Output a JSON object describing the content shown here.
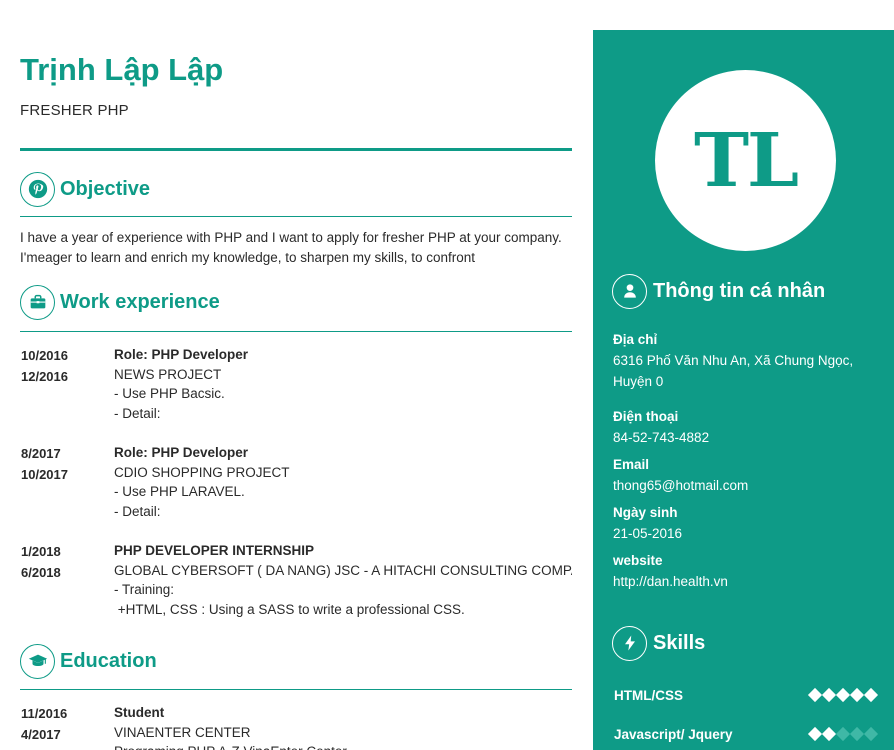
{
  "header": {
    "name": "Trịnh Lập Lập",
    "position": "FRESHER PHP"
  },
  "objective": {
    "title": "Objective",
    "icon": "pinterest-icon",
    "text": "I have a year of experience with PHP and I want to apply for fresher PHP at your company. I'meager to learn and enrich my knowledge, to sharpen my skills, to confront"
  },
  "work": {
    "title": "Work experience",
    "icon": "briefcase-icon",
    "entries": [
      {
        "start": "10/2016",
        "end": "12/2016",
        "lines": [
          "Role: PHP Developer",
          "NEWS PROJECT",
          "- Use PHP Bacsic.",
          "- Detail:"
        ]
      },
      {
        "start": "8/2017",
        "end": "10/2017",
        "lines": [
          "Role: PHP Developer",
          "CDIO SHOPPING PROJECT",
          "- Use PHP LARAVEL.",
          "- Detail:"
        ]
      },
      {
        "start": "1/2018",
        "end": "6/2018",
        "lines": [
          "PHP DEVELOPER INTERNSHIP",
          "GLOBAL CYBERSOFT ( DA NANG) JSC - A HITACHI CONSULTING COMPANY",
          "- Training:",
          " +HTML, CSS : Using a SASS to write a professional CSS."
        ]
      }
    ]
  },
  "education": {
    "title": "Education",
    "icon": "graduation-cap-icon",
    "entries": [
      {
        "start": "11/2016",
        "end": "4/2017",
        "lines": [
          "Student",
          "VINAENTER CENTER",
          "Programing PHP A-Z VinaEnter Center"
        ]
      }
    ]
  },
  "sidebar": {
    "avatar_initials": "TL",
    "personal": {
      "title": "Thông tin cá nhân",
      "icon": "user-icon",
      "address_label": "Địa chỉ",
      "address_line1": "6316 Phố Văn Nhu An, Xã Chung Ngọc,",
      "address_line2": "Huyện 0",
      "phone_label": "Điện thoại",
      "phone": "84-52-743-4882",
      "email_label": "Email",
      "email": "thong65@hotmail.com",
      "birthday_label": "Ngày sinh",
      "birthday": "21-05-2016",
      "website_label": "website",
      "website": "http://dan.health.vn"
    },
    "skills": {
      "title": "Skills",
      "icon": "lightning-icon",
      "items": [
        {
          "name": "HTML/CSS",
          "level": 5,
          "max": 5
        },
        {
          "name": "Javascript/ Jquery",
          "level": 2,
          "max": 5
        }
      ]
    }
  },
  "colors": {
    "accent": "#0e9b87",
    "text": "#2a2a2a",
    "diamond_off": "#3fb8a6"
  }
}
